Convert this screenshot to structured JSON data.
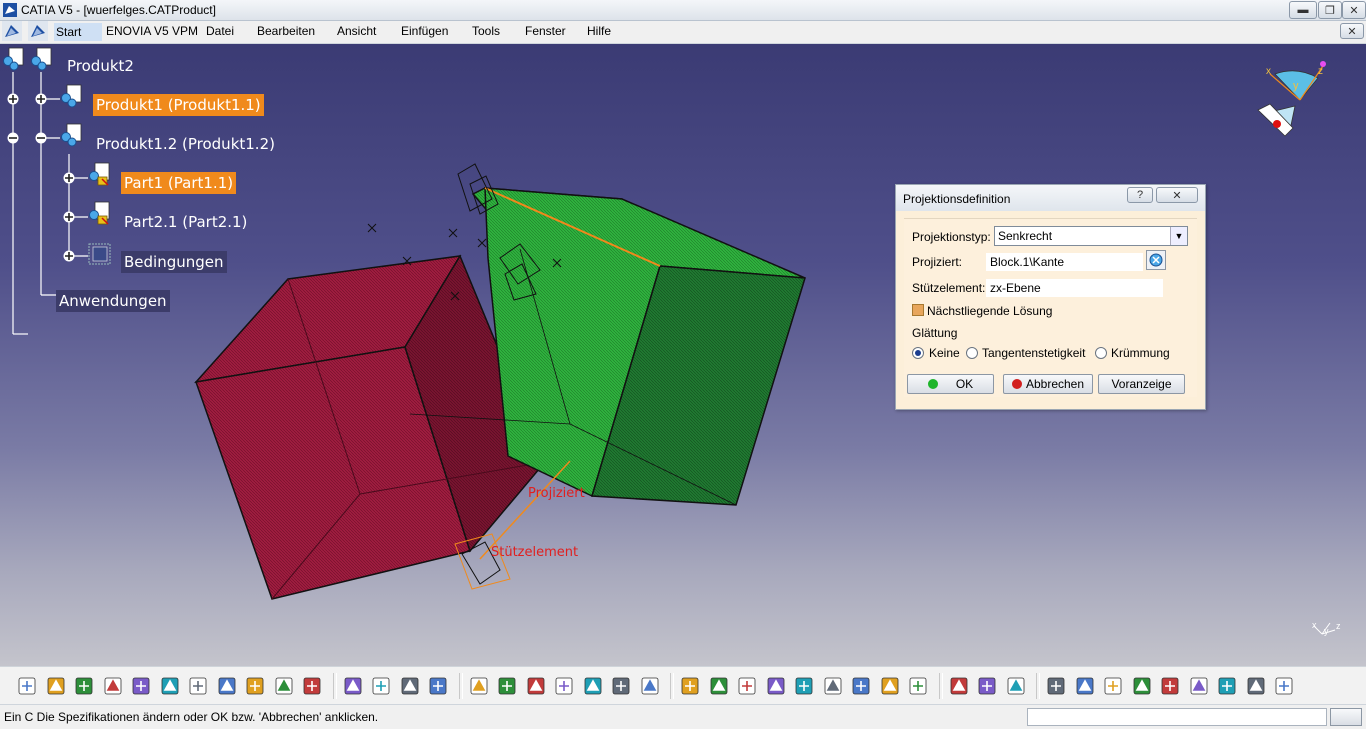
{
  "window": {
    "title": "CATIA V5 - [wuerfelges.CATProduct]",
    "app_icon_letter": "C"
  },
  "menu": {
    "items": [
      "Start",
      "ENOVIA V5 VPM",
      "Datei",
      "Bearbeiten",
      "Ansicht",
      "Einfügen",
      "Tools",
      "Fenster",
      "Hilfe"
    ]
  },
  "tree": {
    "root": "Produkt2",
    "nodes": [
      {
        "label": "Produkt1 (Produkt1.1)",
        "selected": true
      },
      {
        "label": "Produkt1.2 (Produkt1.2)",
        "selected": false
      },
      {
        "label": "Part1 (Part1.1)",
        "selected": true
      },
      {
        "label": "Part2.1 (Part2.1)",
        "selected": false
      },
      {
        "label": "Bedingungen",
        "selected": false
      }
    ],
    "applications": "Anwendungen"
  },
  "scene_labels": {
    "projected": "Projiziert",
    "support": "Stützelement"
  },
  "compass_axes": {
    "x": "x",
    "y": "y",
    "z": "z"
  },
  "axis_triad": {
    "x": "x",
    "y": "y",
    "z": "z"
  },
  "dialog": {
    "title": "Projektionsdefinition",
    "help_button": "?",
    "close_button": "✕",
    "projection_type_label": "Projektionstyp:",
    "projection_type_value": "Senkrecht",
    "projected_label": "Projiziert:",
    "projected_value": "Block.1\\Kante",
    "support_label": "Stützelement:",
    "support_value": "zx-Ebene",
    "nearest_solution_label": "Nächstliegende Lösung",
    "nearest_solution_checked": true,
    "smoothing_label": "Glättung",
    "smoothing_options": [
      "Keine",
      "Tangentenstetigkeit",
      "Krümmung"
    ],
    "smoothing_selected": "Keine",
    "ok_label": "OK",
    "cancel_label": "Abbrechen",
    "preview_label": "Voranzeige"
  },
  "status": {
    "message": "Ein C Die Spezifikationen ändern oder OK bzw. 'Abbrechen' anklicken.",
    "command_value": ""
  },
  "toolbar_icons": [
    "page-icon",
    "new-icon",
    "open-icon",
    "save-icon",
    "print-icon",
    "cut-icon",
    "copy-icon",
    "paste-icon",
    "undo-icon",
    "redo-icon",
    "whats-this-icon",
    "formula-icon",
    "knowledge-icon",
    "macro-icon",
    "table-icon",
    "tree-icon",
    "catalog-icon",
    "product-icon",
    "fly-icon",
    "fit-all-icon",
    "pan-icon",
    "rotate-icon",
    "zoom-in-icon",
    "zoom-out-icon",
    "normal-view-icon",
    "multi-view-icon",
    "iso-view-icon",
    "shading-icon",
    "hide-show-icon",
    "swap-icon",
    "snapshot-icon",
    "manipulation-icon",
    "move-icon",
    "clash-icon",
    "camera-icon",
    "spin-icon",
    "hand-icon",
    "axis-icon",
    "list-icon",
    "grid-icon",
    "layer-icon",
    "box-icon",
    "cursor-icon"
  ],
  "colors": {
    "selection": "#f08a1c",
    "red_body": "#9b1b3c",
    "green_body": "#2aa63a",
    "dialog_bg": "#fcefd9"
  }
}
